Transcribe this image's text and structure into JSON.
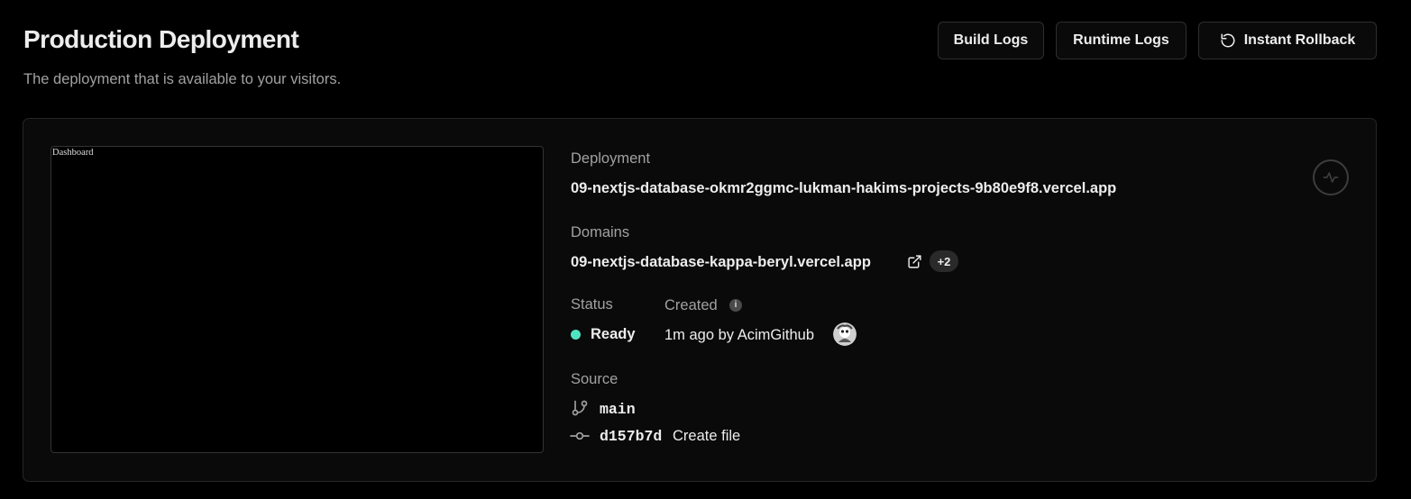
{
  "header": {
    "title": "Production Deployment",
    "subtitle": "The deployment that is available to your visitors."
  },
  "actions": {
    "build_logs": "Build Logs",
    "runtime_logs": "Runtime Logs",
    "instant_rollback": "Instant Rollback",
    "rollback_icon": "rotate-ccw-icon"
  },
  "preview": {
    "text": "Dashboard"
  },
  "deployment": {
    "label": "Deployment",
    "url": "09-nextjs-database-okmr2ggmc-lukman-hakims-projects-9b80e9f8.vercel.app"
  },
  "domains": {
    "label": "Domains",
    "primary": "09-nextjs-database-kappa-beryl.vercel.app",
    "extra_count": "+2"
  },
  "status": {
    "label": "Status",
    "value": "Ready",
    "color": "#50e3c2"
  },
  "created": {
    "label": "Created",
    "value": "1m ago by AcimGithub"
  },
  "source": {
    "label": "Source",
    "branch": "main",
    "commit_sha": "d157b7d",
    "commit_message": "Create file"
  },
  "colors": {
    "background": "#000000",
    "card": "#0a0a0a",
    "text": "#ededed",
    "muted": "#a1a1a1",
    "ready": "#50e3c2"
  }
}
